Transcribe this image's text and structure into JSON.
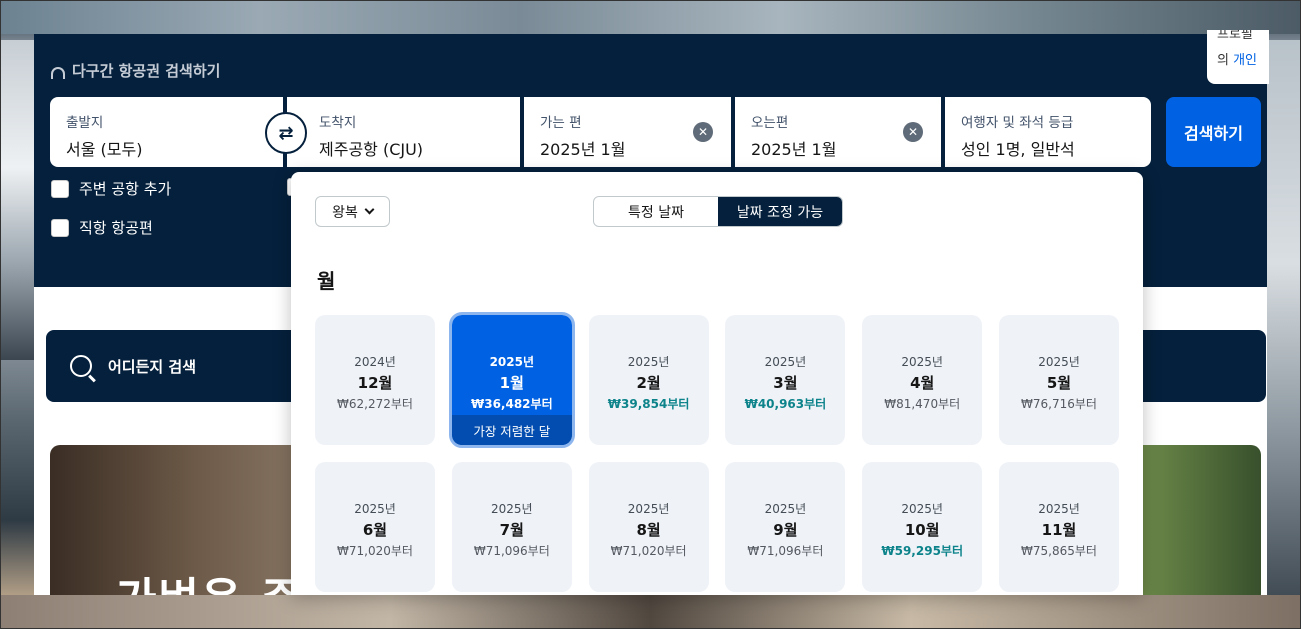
{
  "search_panel": {
    "title": "다구간 항공권 검색하기",
    "origin": {
      "label": "출발지",
      "value": "서울 (모두)"
    },
    "destination": {
      "label": "도착지",
      "value": "제주공항 (CJU)"
    },
    "depart": {
      "label": "가는 편",
      "value": "2025년 1월"
    },
    "return": {
      "label": "오는편",
      "value": "2025년 1월"
    },
    "passengers": {
      "label": "여행자 및 좌석 등급",
      "value": "성인 1명, 일반석"
    },
    "search_button": "검색하기",
    "swap_icon": "⇄",
    "clear_icon": "✕",
    "checkbox_nearby": "주변 공항 추가",
    "checkbox_direct": "직항 항공편"
  },
  "cookie_note": {
    "line1": "프로필",
    "line2_prefix": "의 ",
    "line2_link": "개인"
  },
  "anywhere": {
    "label": "어디든지 검색"
  },
  "promo": {
    "headline": "가벼운 주"
  },
  "date_picker": {
    "trip_type": "왕복",
    "toggle": {
      "specific": "특정 날짜",
      "flexible": "날짜 조정 가능"
    },
    "heading": "월",
    "months": [
      {
        "year": "2024년",
        "month": "12월",
        "price": "₩62,272부터",
        "cheap": false
      },
      {
        "year": "2025년",
        "month": "1월",
        "price": "₩36,482부터",
        "cheap": true,
        "selected": true,
        "badge": "가장 저렴한 달"
      },
      {
        "year": "2025년",
        "month": "2월",
        "price": "₩39,854부터",
        "cheap": true
      },
      {
        "year": "2025년",
        "month": "3월",
        "price": "₩40,963부터",
        "cheap": true
      },
      {
        "year": "2025년",
        "month": "4월",
        "price": "₩81,470부터",
        "cheap": false
      },
      {
        "year": "2025년",
        "month": "5월",
        "price": "₩76,716부터",
        "cheap": false
      },
      {
        "year": "2025년",
        "month": "6월",
        "price": "₩71,020부터",
        "cheap": false
      },
      {
        "year": "2025년",
        "month": "7월",
        "price": "₩71,096부터",
        "cheap": false
      },
      {
        "year": "2025년",
        "month": "8월",
        "price": "₩71,020부터",
        "cheap": false
      },
      {
        "year": "2025년",
        "month": "9월",
        "price": "₩71,096부터",
        "cheap": false
      },
      {
        "year": "2025년",
        "month": "10월",
        "price": "₩59,295부터",
        "cheap": true
      },
      {
        "year": "2025년",
        "month": "11월",
        "price": "₩75,865부터",
        "cheap": false
      }
    ]
  }
}
